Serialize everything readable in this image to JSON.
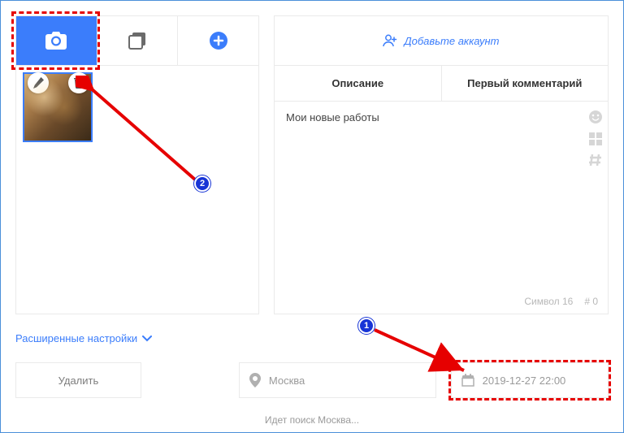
{
  "leftTabs": {
    "active": 0
  },
  "addAccount": "Добавьте аккаунт",
  "rightTabs": {
    "desc": "Описание",
    "firstComment": "Первый комментарий"
  },
  "description": "Мои новые работы",
  "charCounter": {
    "symbolLabel": "Символ 16",
    "hashLabel": "# 0"
  },
  "advSettings": "Расширенные настройки",
  "deleteLabel": "Удалить",
  "location": "Москва",
  "dateTime": "2019-12-27 22:00",
  "searchStatus": "Идет поиск Москва...",
  "badges": {
    "one": "1",
    "two": "2"
  }
}
